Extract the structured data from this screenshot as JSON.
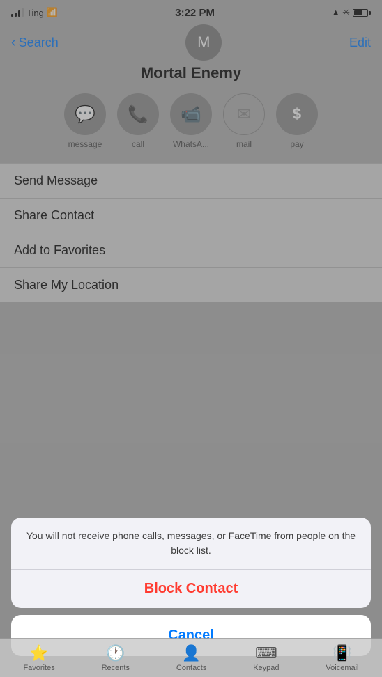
{
  "statusBar": {
    "carrier": "Ting",
    "time": "3:22 PM",
    "icons": {
      "wifi": "wifi",
      "bluetooth": "bluetooth",
      "location": "location"
    }
  },
  "nav": {
    "back_label": "Search",
    "edit_label": "Edit",
    "avatar_initial": "M"
  },
  "contact": {
    "name": "Mortal Enemy"
  },
  "actions": [
    {
      "id": "message",
      "label": "message",
      "icon": "💬"
    },
    {
      "id": "call",
      "label": "call",
      "icon": "📞"
    },
    {
      "id": "whatsapp",
      "label": "WhatsA...",
      "icon": "📹"
    },
    {
      "id": "mail",
      "label": "mail",
      "icon": "✉",
      "style": "outline"
    },
    {
      "id": "pay",
      "label": "pay",
      "icon": "$"
    }
  ],
  "listItems": [
    "Send Message",
    "Share Contact",
    "Add to Favorites",
    "Share My Location"
  ],
  "alert": {
    "message": "You will not receive phone calls, messages, or FaceTime from people on the block list.",
    "action_label": "Block Contact",
    "cancel_label": "Cancel"
  },
  "tabBar": [
    {
      "id": "favorites",
      "label": "Favorites",
      "icon": "⭐"
    },
    {
      "id": "recents",
      "label": "Recents",
      "icon": "🕐"
    },
    {
      "id": "contacts",
      "label": "Contacts",
      "icon": "👤"
    },
    {
      "id": "keypad",
      "label": "Keypad",
      "icon": "⌨"
    },
    {
      "id": "voicemail",
      "label": "Voicemail",
      "icon": "📳"
    }
  ]
}
